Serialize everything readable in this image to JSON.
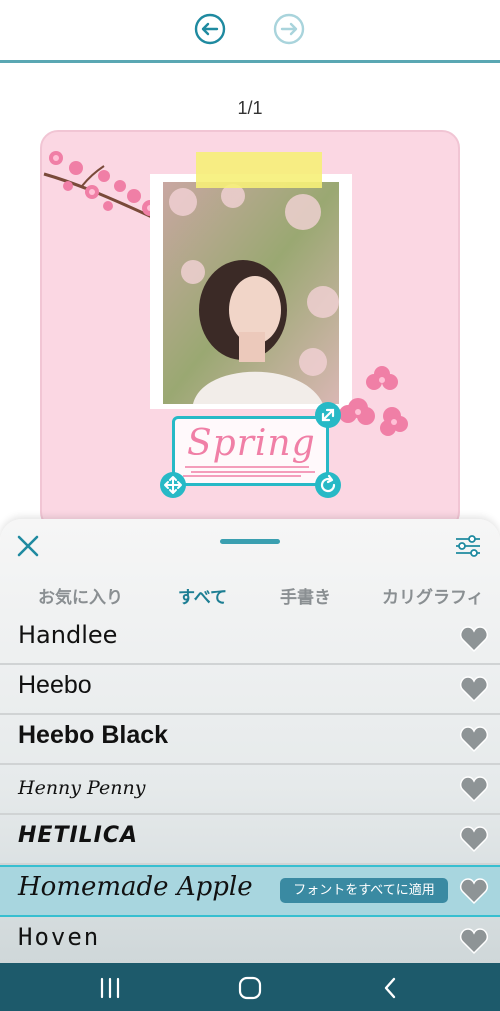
{
  "toolbar": {
    "undo_icon": "undo-icon",
    "redo_icon": "redo-icon"
  },
  "page_indicator": "1/1",
  "canvas": {
    "text_element": "Spring",
    "photo_description_icon": "photo"
  },
  "sheet": {
    "tabs": [
      {
        "label": "お気に入り",
        "active": false
      },
      {
        "label": "すべて",
        "active": true
      },
      {
        "label": "手書き",
        "active": false
      },
      {
        "label": "カリグラフィ",
        "active": false
      }
    ],
    "fonts": [
      {
        "name": "Handlee",
        "selected": false
      },
      {
        "name": "Heebo",
        "selected": false
      },
      {
        "name": "Heebo Black",
        "selected": false
      },
      {
        "name": "Henny Penny",
        "selected": false
      },
      {
        "name": "HETILICA",
        "selected": false
      },
      {
        "name": "Homemade Apple",
        "selected": true
      },
      {
        "name": "Hoven",
        "selected": false
      }
    ],
    "apply_all_label": "フォントをすべてに適用"
  },
  "colors": {
    "accent": "#27b9c6",
    "tab_active": "#1d7e93",
    "card_bg": "#fbd7e3",
    "navbar": "#1d5a6b"
  }
}
